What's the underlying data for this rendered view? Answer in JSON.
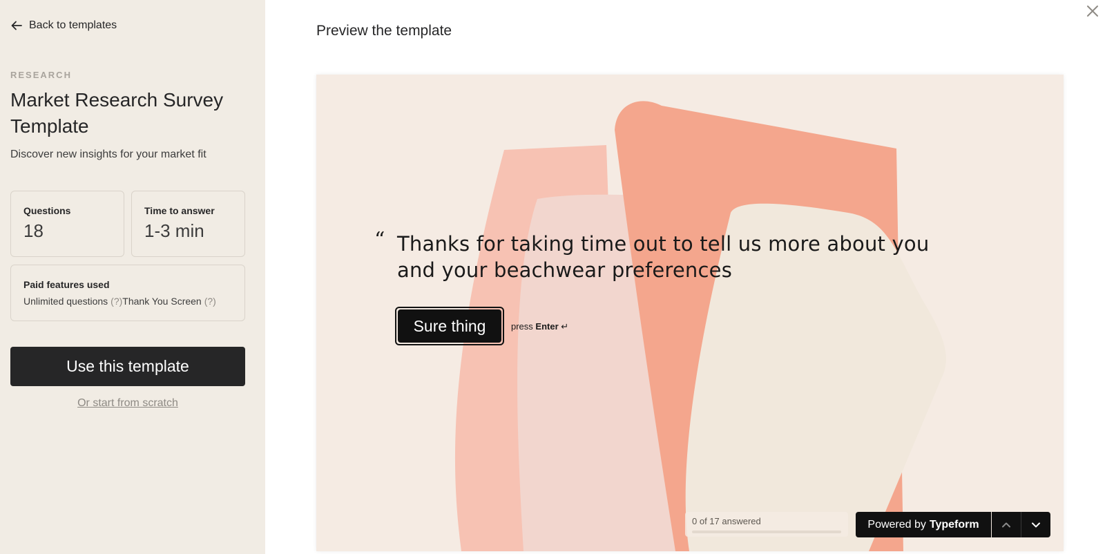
{
  "sidebar": {
    "back_label": "Back to templates",
    "category": "RESEARCH",
    "title": "Market Research Survey Template",
    "description": "Discover new insights for your market fit",
    "stats": {
      "questions_label": "Questions",
      "questions_value": "18",
      "time_label": "Time to answer",
      "time_value": "1-3 min"
    },
    "paid": {
      "label": "Paid features used",
      "features": [
        {
          "name": "Unlimited questions",
          "help": "(?)"
        },
        {
          "name": "Thank You Screen",
          "help": "(?)"
        }
      ]
    },
    "use_button": "Use this template",
    "scratch_link": "Or start from scratch"
  },
  "preview": {
    "heading": "Preview the template",
    "quote_mark": "“",
    "welcome_text": "Thanks for taking time out to tell us more about you and your beachwear preferences",
    "cta_button": "Sure thing",
    "press_prefix": "press",
    "press_key": "Enter",
    "enter_symbol": "↵",
    "progress_text": "0 of 17 answered",
    "progress_fraction": 0,
    "powered_prefix": "Powered by",
    "powered_brand": "Typeform"
  },
  "colors": {
    "sidebar_bg": "#f1ece4",
    "preview_bg": "#f5ebe3",
    "accent_dark": "#262627",
    "shape_salmon": "#f4a68d",
    "shape_pink": "#f7c2b3",
    "shape_cream": "#f1e8dc"
  },
  "icons": {
    "back": "arrow-left-icon",
    "close": "close-icon",
    "up": "chevron-up-icon",
    "down": "chevron-down-icon",
    "enter": "enter-return-icon"
  }
}
